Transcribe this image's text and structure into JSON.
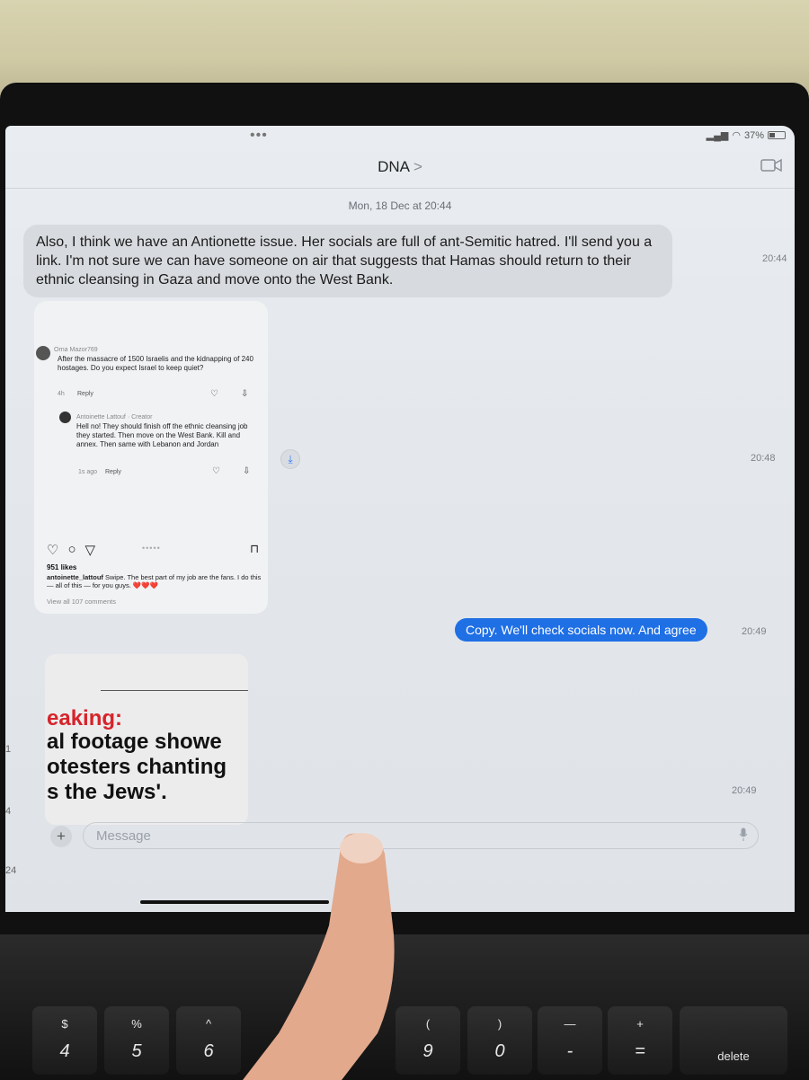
{
  "status": {
    "dots": "•••",
    "battery_text": "37%"
  },
  "header": {
    "contact_name": "DNA",
    "chevron": ">"
  },
  "conversation": {
    "day_timestamp": "Mon, 18 Dec at 20:44",
    "messages": [
      {
        "direction": "incoming",
        "text": "Also, I think we have an Antionette issue. Her socials are full of ant-Semitic hatred. I'll send you a link. I'm not sure we can have someone on air that suggests that Hamas should return to their ethnic cleansing in Gaza and move onto the West Bank.",
        "time": "20:44"
      },
      {
        "direction": "incoming",
        "type": "image",
        "time": "20:48"
      },
      {
        "direction": "outgoing",
        "text": "Copy. We'll check socials now. And agree",
        "time": "20:49"
      },
      {
        "direction": "incoming",
        "type": "image",
        "time": "20:49"
      }
    ]
  },
  "insta": {
    "comment1": {
      "user": "Orna Mazor769",
      "text": "After the massacre of 1500 Israelis and the kidnapping of 240 hostages. Do you expect Israel to keep quiet?",
      "age": "4h",
      "reply": "Reply"
    },
    "comment2": {
      "user": "Antoinette Lattouf · Creator",
      "text": "Hell no! They should finish off the ethnic cleansing job they started. Then move on the West Bank. Kill and annex. Then same with Lebanon and Jordan",
      "age": "1s ago",
      "reply": "Reply"
    },
    "likes": "951 likes",
    "caption_user": "antoinette_lattouf",
    "caption": "Swipe. The best part of my job are the fans. I do this — all of this — for you guys. ❤️❤️❤️",
    "view_all": "View all 107 comments"
  },
  "news": {
    "breaking": "eaking:",
    "line1": "al footage showe",
    "line2": "otesters chanting",
    "line3": "s the Jews'."
  },
  "composer": {
    "placeholder": "Message",
    "plus": "+"
  },
  "sidebar": {
    "numbers": [
      "1",
      "4",
      "24"
    ]
  },
  "keyboard": {
    "keys": [
      {
        "top": "$",
        "bottom": "4"
      },
      {
        "top": "%",
        "bottom": "5"
      },
      {
        "top": "^",
        "bottom": "6"
      },
      {
        "top": "(",
        "bottom": "9"
      },
      {
        "top": ")",
        "bottom": "0"
      },
      {
        "top": "—",
        "bottom": "-"
      },
      {
        "top": "+",
        "bottom": "="
      }
    ],
    "delete": "delete"
  },
  "colors": {
    "outgoing_bubble": "#1f6fe5",
    "incoming_bubble": "#d7dade",
    "breaking_red": "#d6232a"
  }
}
